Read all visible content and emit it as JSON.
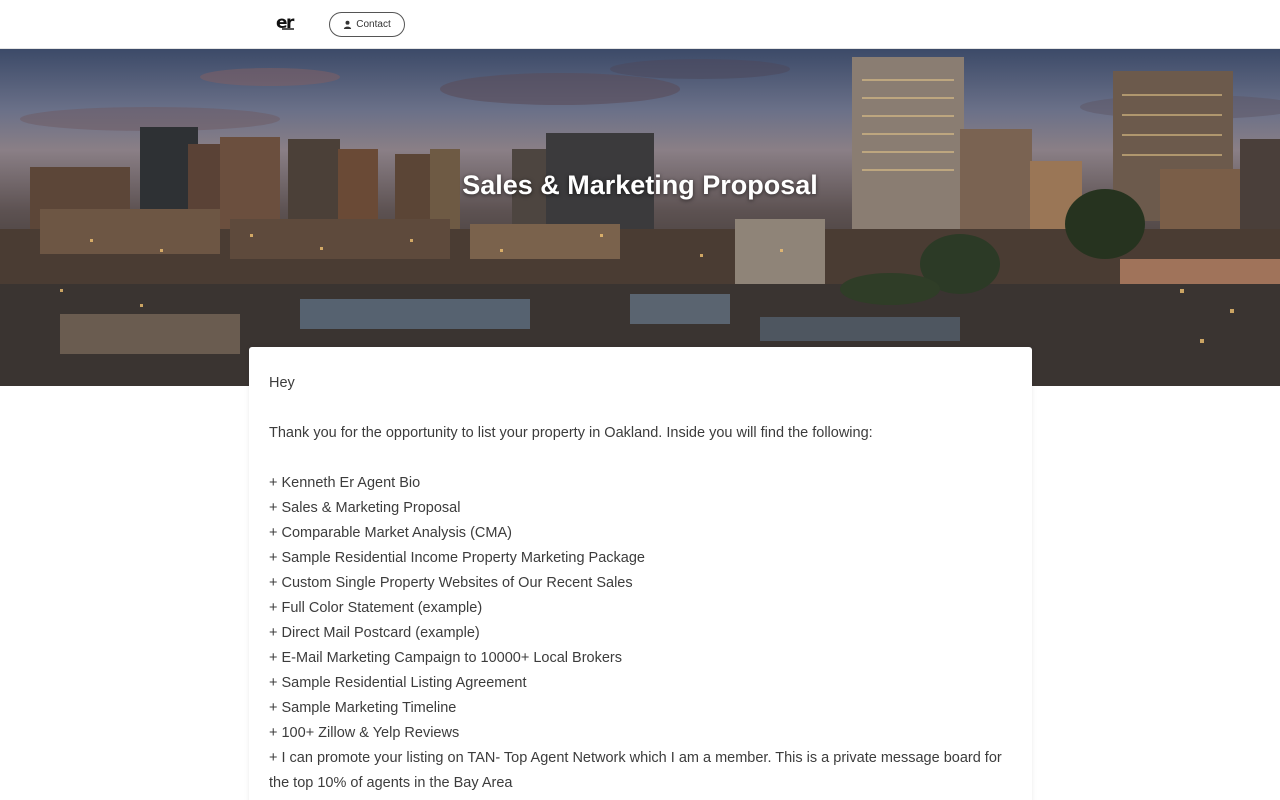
{
  "header": {
    "logo_text": "er",
    "contact_label": "Contact"
  },
  "hero": {
    "title": "Sales & Marketing Proposal"
  },
  "content": {
    "greeting": "Hey",
    "intro": "Thank you for the opportunity to list your property in Oakland. Inside you will find the following:",
    "items": [
      "+ Kenneth Er Agent Bio",
      "+ Sales & Marketing Proposal",
      "+ Comparable Market Analysis (CMA)",
      "+ Sample Residential Income Property Marketing Package",
      "+ Custom Single Property Websites of Our Recent Sales",
      "+ Full Color Statement (example)",
      "+ Direct Mail Postcard (example)",
      "+ E-Mail Marketing Campaign to 10000+ Local Brokers",
      "+ Sample Residential Listing Agreement",
      "+ Sample Marketing Timeline",
      "+ 100+ Zillow & Yelp Reviews",
      "+ I can promote your listing on TAN- Top Agent Network which I am a member.  This is a private message board for the top 10% of agents in the Bay Area"
    ]
  },
  "icons": {
    "contact": "person-icon"
  }
}
